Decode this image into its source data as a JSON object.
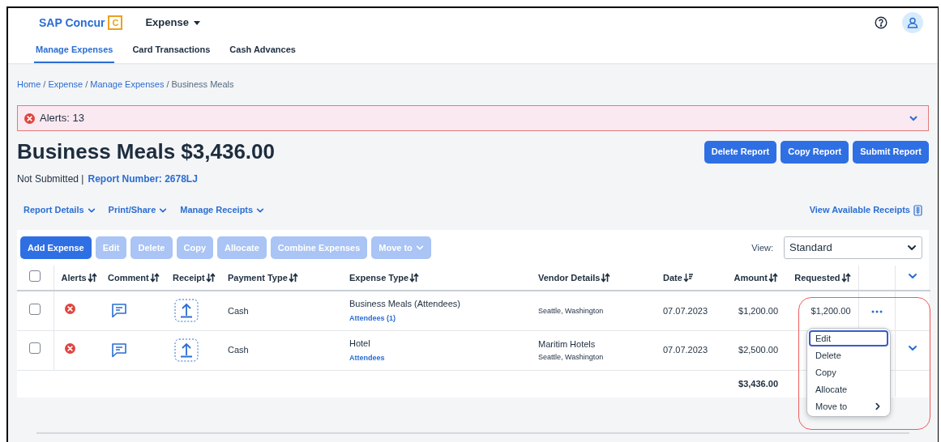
{
  "app": {
    "brand": "SAP Concur",
    "brand_mark": "C",
    "module": "Expense"
  },
  "tabs": [
    {
      "label": "Manage Expenses",
      "selected": true
    },
    {
      "label": "Card Transactions",
      "selected": false
    },
    {
      "label": "Cash Advances",
      "selected": false
    }
  ],
  "breadcrumb": [
    {
      "label": "Home",
      "kind": "link"
    },
    {
      "label": "/",
      "kind": "separator"
    },
    {
      "label": "Expense",
      "kind": "link"
    },
    {
      "label": "/",
      "kind": "separator"
    },
    {
      "label": "Manage Expenses",
      "kind": "link"
    },
    {
      "label": "/",
      "kind": "separator"
    },
    {
      "label": "Business Meals",
      "kind": "current"
    }
  ],
  "alert": {
    "text": "Alerts: 13",
    "expanded": false
  },
  "report": {
    "title": "Business Meals $3,436.00",
    "status": "Not Submitted |",
    "number": "Report Number: 2678LJ"
  },
  "report_actions": [
    "Delete Report",
    "Copy Report",
    "Submit Report"
  ],
  "menus": [
    "Report Details",
    "Print/Share",
    "Manage Receipts"
  ],
  "receipts_link": "View Available Receipts",
  "toolbar": [
    {
      "label": "Add Expense",
      "disabled": false,
      "dropdown": false
    },
    {
      "label": "Edit",
      "disabled": true,
      "dropdown": false
    },
    {
      "label": "Delete",
      "disabled": true,
      "dropdown": false
    },
    {
      "label": "Copy",
      "disabled": true,
      "dropdown": false
    },
    {
      "label": "Allocate",
      "disabled": true,
      "dropdown": false
    },
    {
      "label": "Combine Expenses",
      "disabled": true,
      "dropdown": false
    },
    {
      "label": "Move to",
      "disabled": true,
      "dropdown": true
    }
  ],
  "view": {
    "label": "View:",
    "value": "Standard"
  },
  "table": {
    "select_all": false,
    "columns": [
      {
        "label": "Alerts",
        "kind": "sortable"
      },
      {
        "label": "Comment",
        "kind": "sortable"
      },
      {
        "label": "Receipt",
        "kind": "sortable"
      },
      {
        "label": "Payment Type",
        "kind": "sortable"
      },
      {
        "label": "Expense Type",
        "kind": "sortable"
      },
      {
        "label": "Vendor Details",
        "kind": "sortable"
      },
      {
        "label": "Date",
        "kind": "descending"
      },
      {
        "label": "Amount",
        "kind": "sortable"
      },
      {
        "label": "Requested",
        "kind": "sortable"
      }
    ],
    "rows": [
      {
        "checked": false,
        "alert": true,
        "payment_type": "Cash",
        "expense_type": "Business Meals (Attendees)",
        "attendees": "Attendees (1)",
        "vendor_location": "Seattle, Washington",
        "date": "07.07.2023",
        "amount": "$1,200.00",
        "requested": "$1,200.00",
        "more_button": true,
        "expand_button": false
      },
      {
        "checked": false,
        "alert": true,
        "payment_type": "Cash",
        "expense_type": "Hotel",
        "attendees": "Attendees",
        "vendor_name": "Maritim Hotels",
        "vendor_location": "Seattle, Washington",
        "date": "07.07.2023",
        "amount": "$2,500.00",
        "more_button": false,
        "expand_button": true
      }
    ],
    "total": "$3,436.00"
  },
  "row_menu": {
    "items": [
      {
        "label": "Edit",
        "selected": true,
        "submenu": false
      },
      {
        "label": "Delete",
        "selected": false,
        "submenu": false
      },
      {
        "label": "Copy",
        "selected": false,
        "submenu": false
      },
      {
        "label": "Allocate",
        "selected": false,
        "submenu": false
      },
      {
        "label": "Move to",
        "selected": false,
        "submenu": true
      }
    ]
  }
}
